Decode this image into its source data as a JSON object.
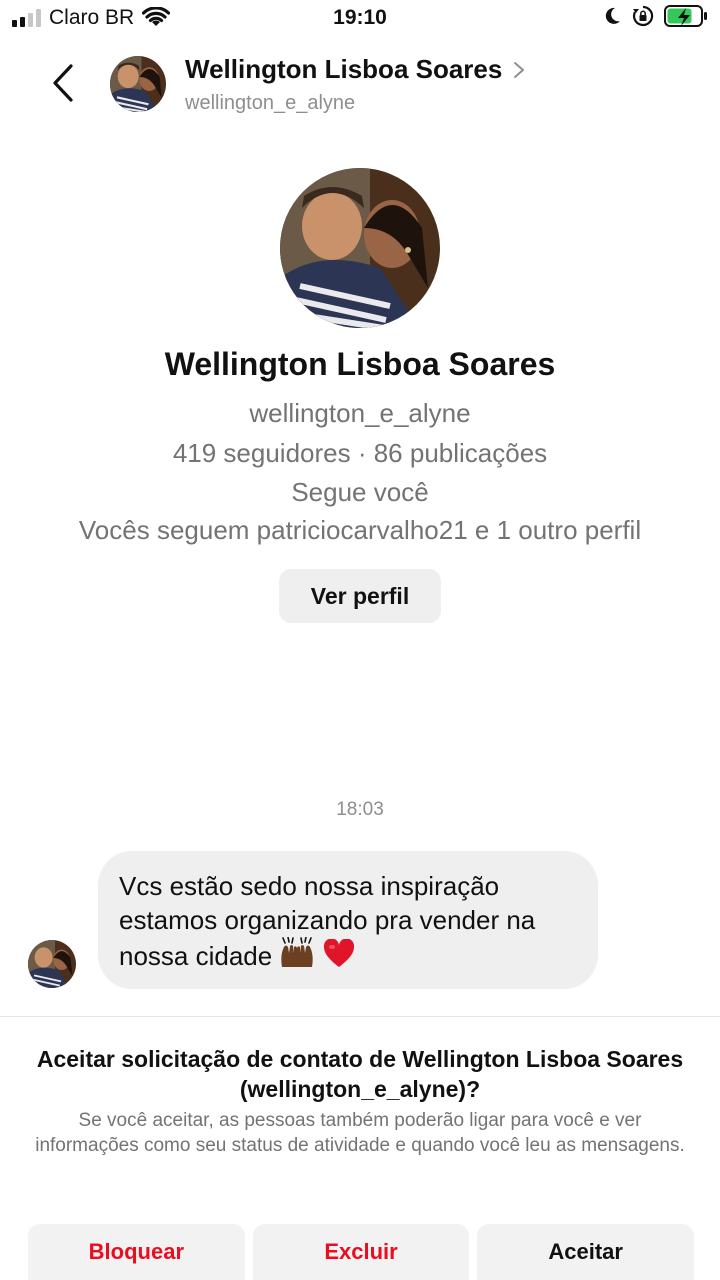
{
  "status_bar": {
    "carrier": "Claro BR",
    "time": "19:10"
  },
  "header": {
    "name": "Wellington Lisboa Soares",
    "username": "wellington_e_alyne"
  },
  "profile": {
    "name": "Wellington Lisboa Soares",
    "username": "wellington_e_alyne",
    "stats": "419 seguidores · 86 publicações",
    "follows_you": "Segue você",
    "mutual": "Vocês seguem patriciocarvalho21 e 1 outro perfil",
    "view_profile_label": "Ver perfil"
  },
  "conversation": {
    "timestamp": "18:03",
    "message": {
      "line1": "Vcs estão sedo nossa inspiração",
      "line2": "estamos organizando pra vender na",
      "line3": "nossa cidade"
    }
  },
  "request": {
    "title": "Aceitar solicitação de contato de Wellington Lisboa Soares (wellington_e_alyne)?",
    "description": "Se você aceitar, as pessoas também poderão ligar para você e ver informações como seu status de atividade e quando você leu as mensagens.",
    "block_label": "Bloquear",
    "delete_label": "Excluir",
    "accept_label": "Aceitar"
  },
  "colors": {
    "destructive": "#ed0b1f",
    "secondary_text": "#737373",
    "button_bg": "#efefef"
  },
  "icons": [
    "signal-icon",
    "wifi-icon",
    "moon-icon",
    "rotation-lock-icon",
    "battery-icon",
    "back-chevron-icon",
    "chevron-right-icon",
    "raised-hands-emoji",
    "red-heart-emoji"
  ]
}
